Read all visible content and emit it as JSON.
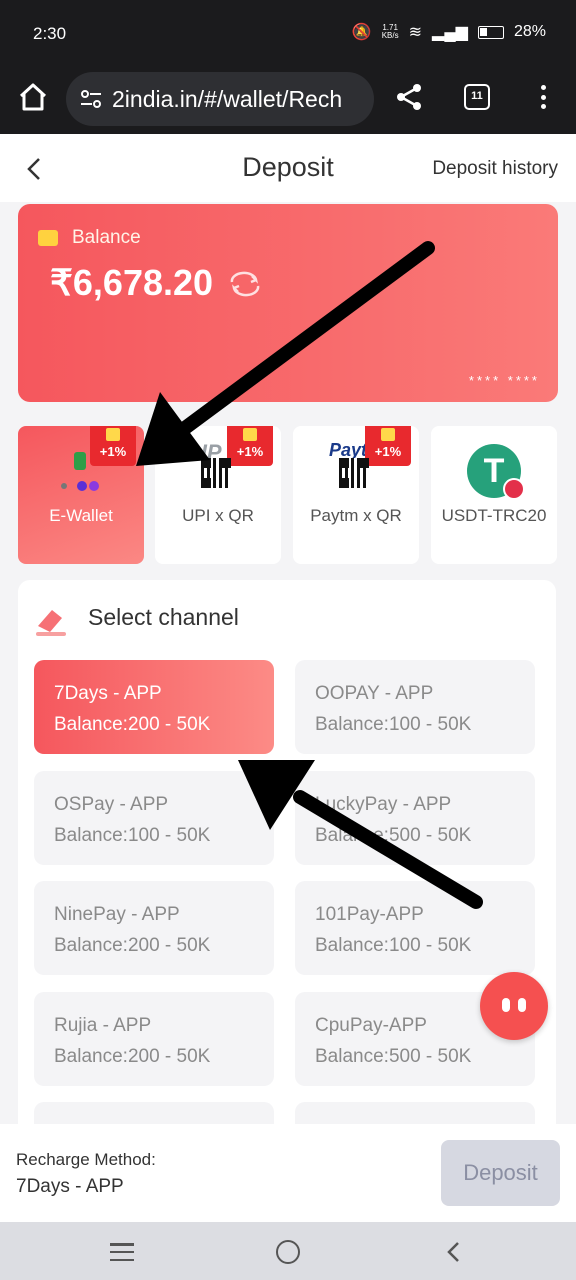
{
  "status_bar": {
    "time": "2:30",
    "net_speed_top": "1.71",
    "net_speed_bottom": "KB/s",
    "battery": "28%"
  },
  "browser": {
    "url": "2india.in/#/wallet/Rech",
    "tab_count": "11"
  },
  "header": {
    "title": "Deposit",
    "history_link": "Deposit history"
  },
  "balance": {
    "label": "Balance",
    "amount": "₹6,678.20",
    "card_mask": "****  ****"
  },
  "methods": [
    {
      "label": "E-Wallet",
      "bonus": "+1%",
      "active": true
    },
    {
      "label": "UPI x QR",
      "bonus": "+1%",
      "logo": "UP"
    },
    {
      "label": "Paytm x QR",
      "bonus": "+1%",
      "logo": "Paytm"
    },
    {
      "label": "USDT-TRC20",
      "logo": "T"
    }
  ],
  "channel": {
    "title": "Select channel",
    "items": [
      {
        "name": "7Days - APP",
        "range": "Balance:200 - 50K",
        "active": true
      },
      {
        "name": "OOPAY - APP",
        "range": "Balance:100 - 50K"
      },
      {
        "name": "OSPay - APP",
        "range": "Balance:100 - 50K"
      },
      {
        "name": "LuckyPay - APP",
        "range": "Balance:500 - 50K"
      },
      {
        "name": "NinePay - APP",
        "range": "Balance:200 - 50K"
      },
      {
        "name": "101Pay-APP",
        "range": "Balance:100 - 50K"
      },
      {
        "name": "Rujia - APP",
        "range": "Balance:200 - 50K"
      },
      {
        "name": "CpuPay-APP",
        "range": "Balance:500 - 50K"
      }
    ]
  },
  "footer": {
    "method_label": "Recharge Method:",
    "method_value": "7Days - APP",
    "deposit_button": "Deposit"
  },
  "colors": {
    "accent": "#f5575d",
    "button_disabled": "#d6d8e1",
    "browser_bar": "#1b1b1d"
  }
}
